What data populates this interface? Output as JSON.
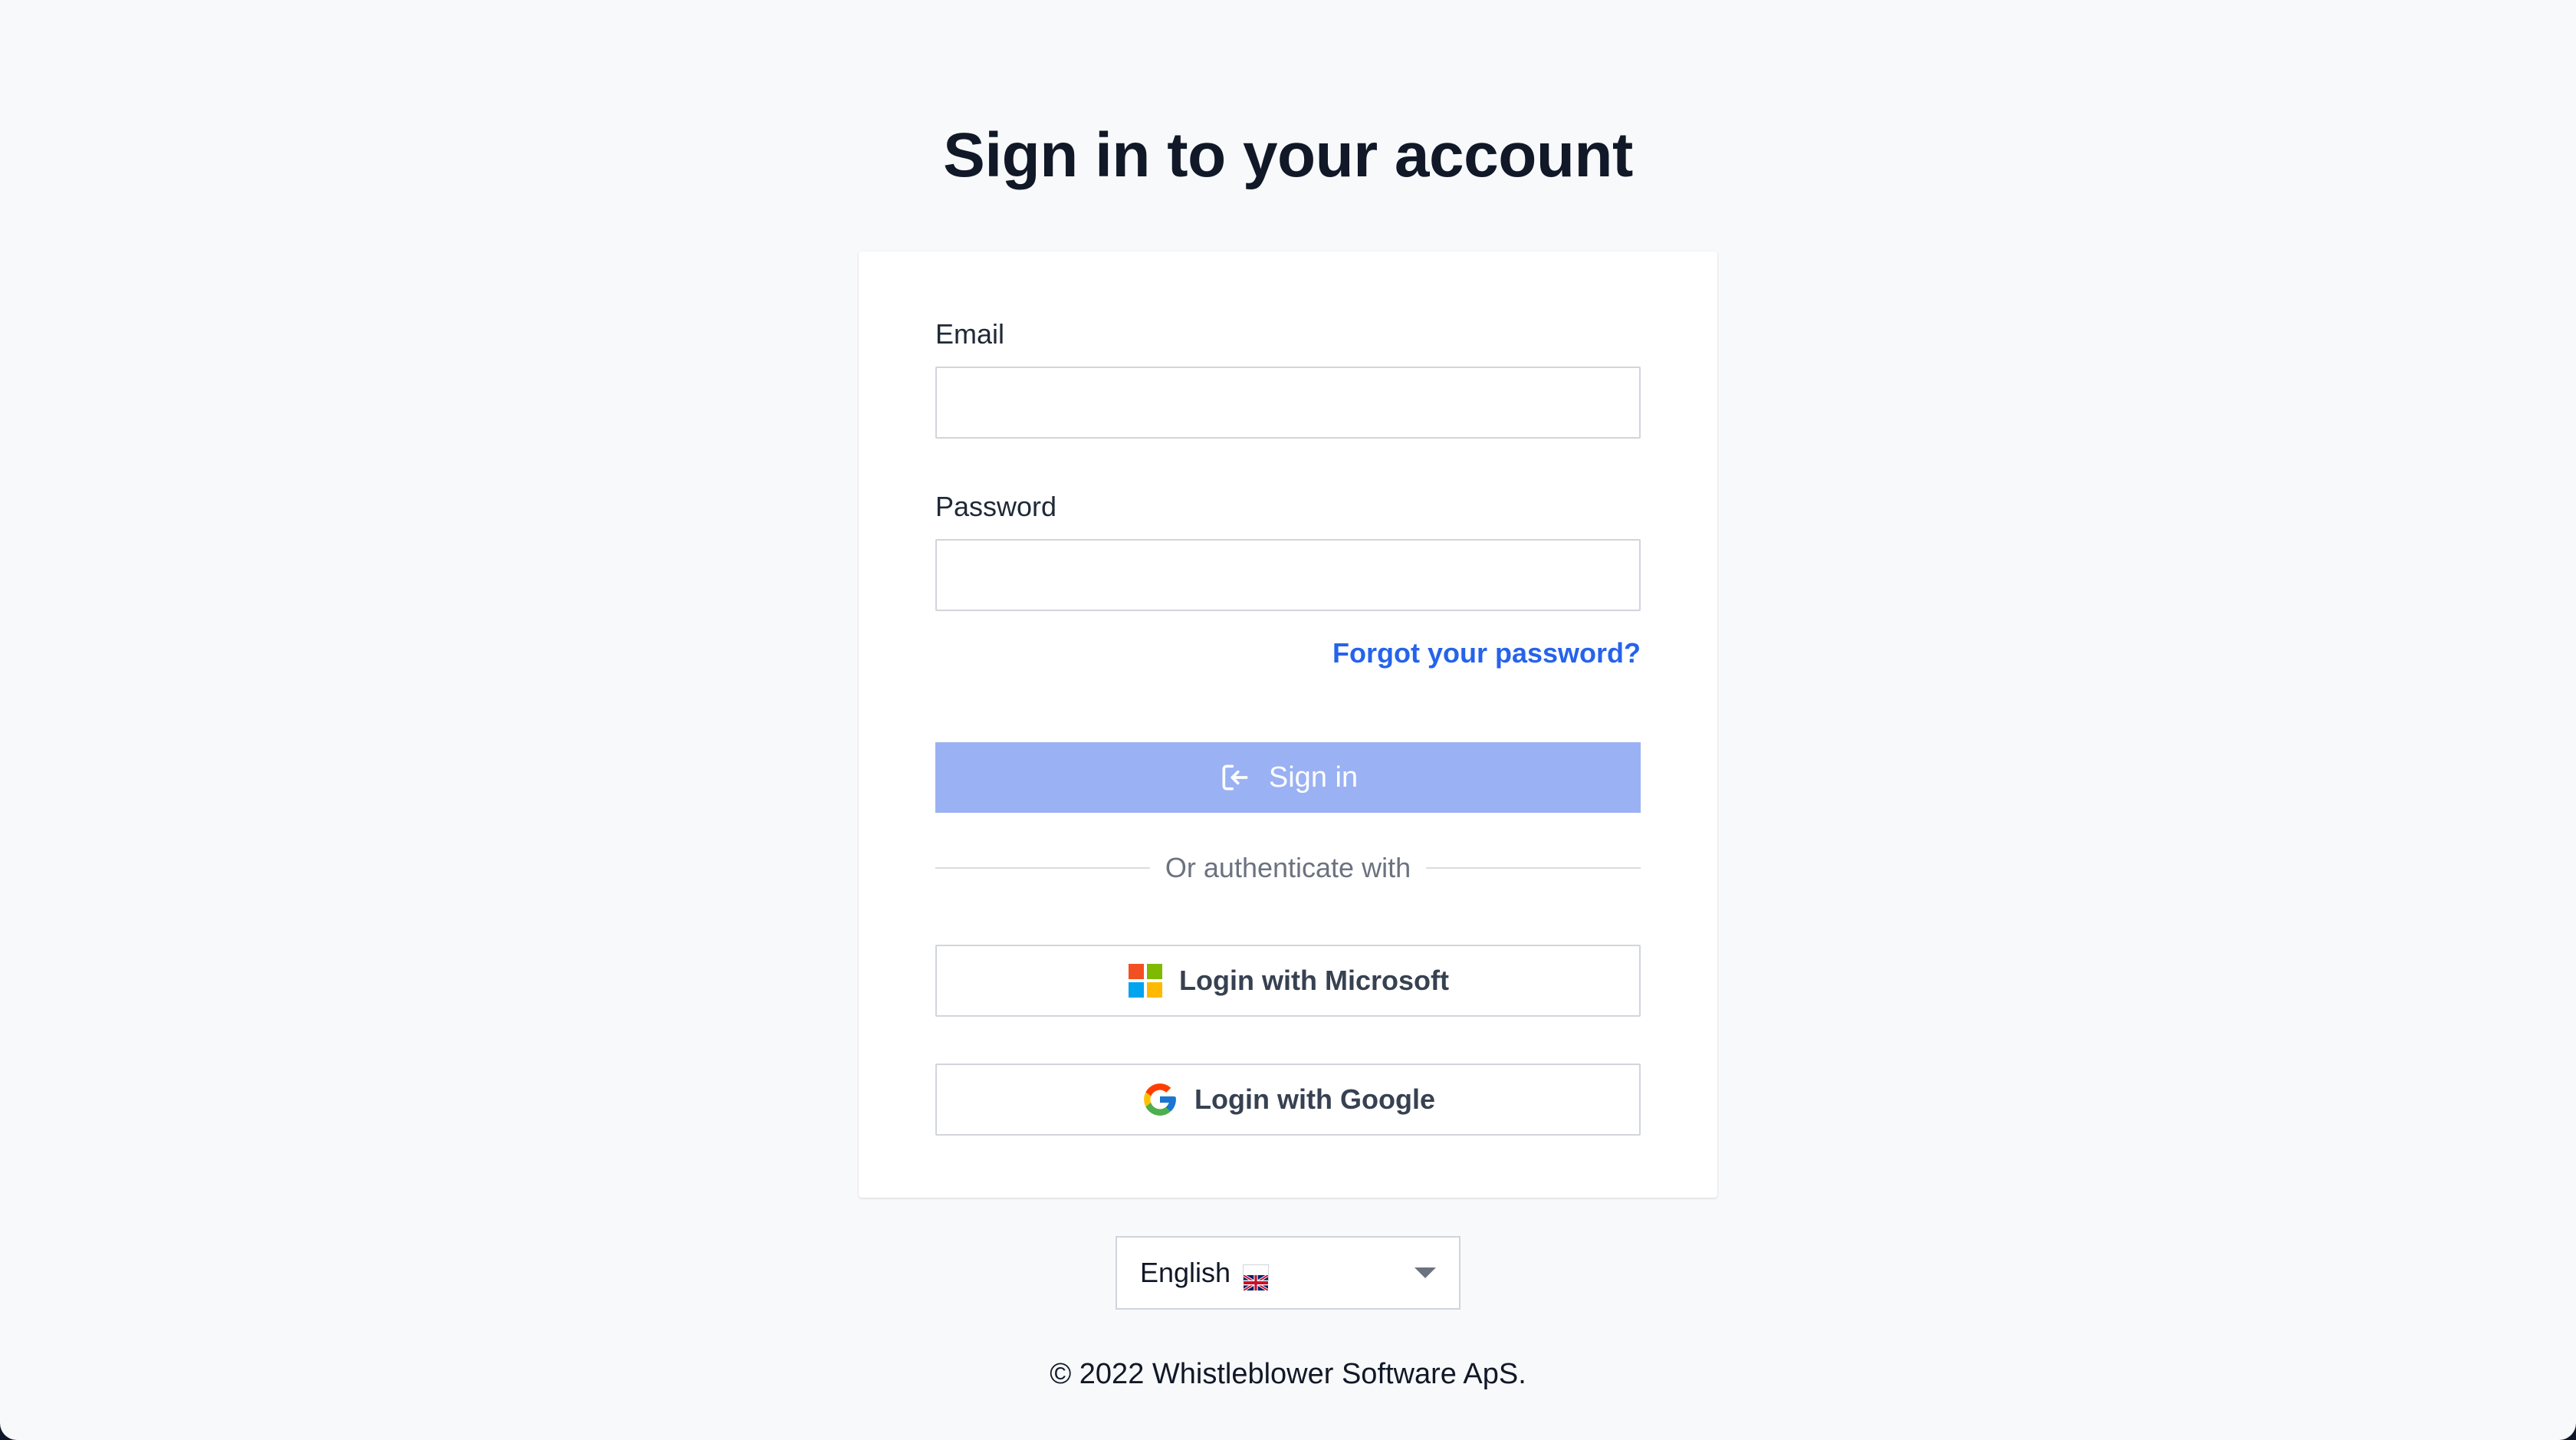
{
  "page": {
    "title": "Sign in to your account",
    "footer": "© 2022 Whistleblower Software ApS."
  },
  "form": {
    "email_label": "Email",
    "email_value": "",
    "password_label": "Password",
    "password_value": "",
    "forgot_link": "Forgot your password?",
    "signin_label": "Sign in",
    "divider_text": "Or authenticate with",
    "microsoft_label": "Login with Microsoft",
    "google_label": "Login with Google"
  },
  "language": {
    "selected": "English",
    "flag_icon": "uk-flag-icon"
  },
  "colors": {
    "background": "#f8f9fb",
    "card": "#ffffff",
    "link": "#2563eb",
    "signin_button": "#9ab1f3",
    "text": "#111827"
  }
}
